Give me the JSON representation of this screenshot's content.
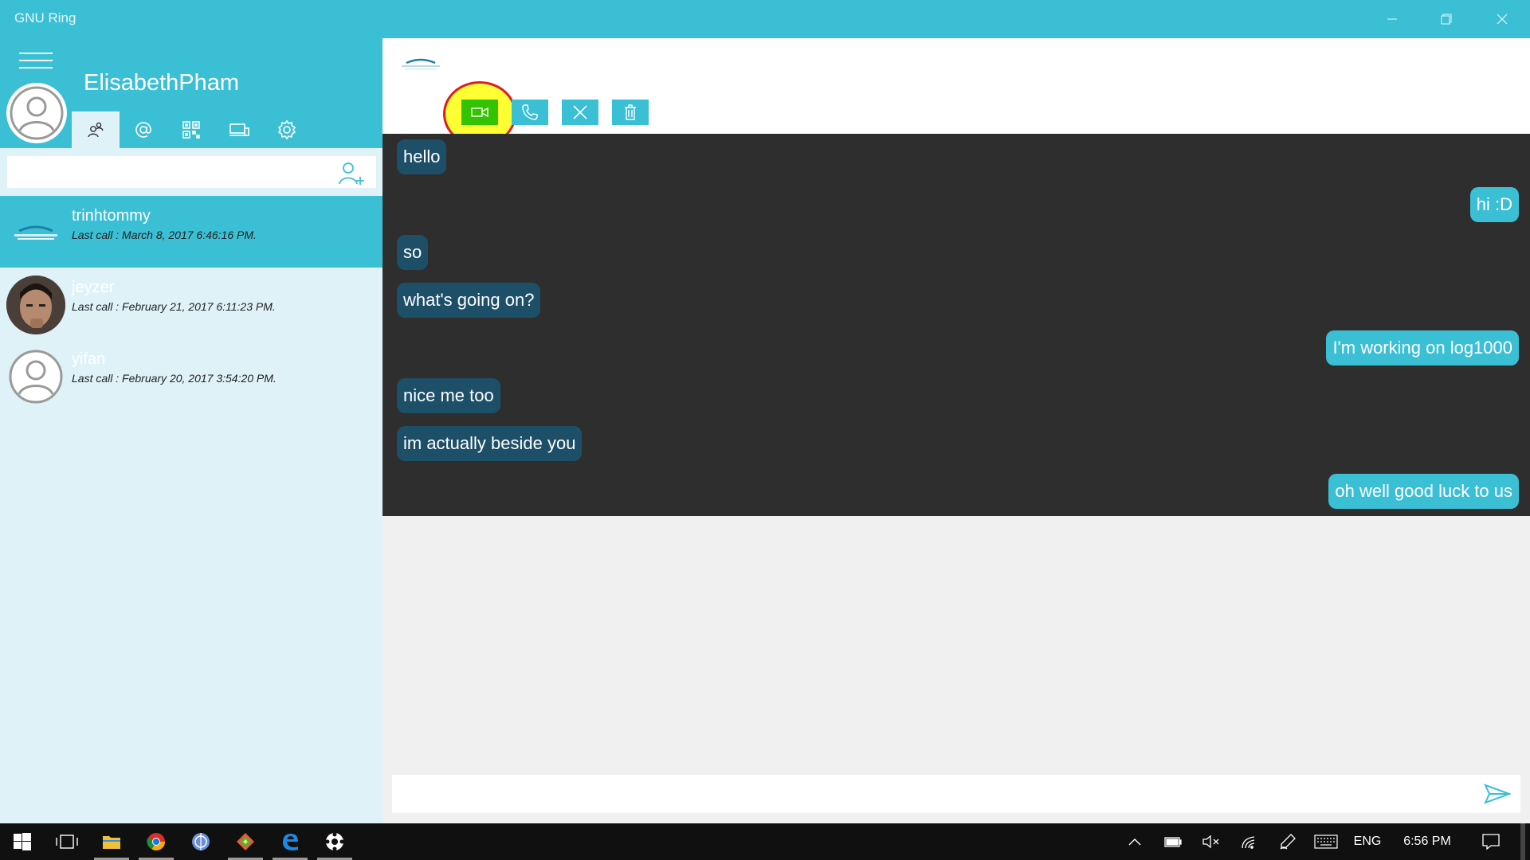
{
  "window": {
    "title": "GNU Ring"
  },
  "sidebar": {
    "username": "ElisabethPham",
    "tabs": [
      {
        "icon": "contacts-icon",
        "active": true
      },
      {
        "icon": "at-icon",
        "active": false
      },
      {
        "icon": "qr-code-icon",
        "active": false
      },
      {
        "icon": "devices-icon",
        "active": false
      },
      {
        "icon": "gear-icon",
        "active": false
      }
    ],
    "search": {
      "value": "",
      "placeholder": ""
    },
    "contacts": [
      {
        "name": "trinhtommy",
        "last": "Last call : March 8, 2017 6:46:16 PM.",
        "active": true
      },
      {
        "name": "jeyzer",
        "last": "Last call : February 21, 2017 6:11:23 PM.",
        "active": false
      },
      {
        "name": "yifan",
        "last": "Last call : February 20, 2017 3:54:20 PM.",
        "active": false
      }
    ]
  },
  "conversation": {
    "actions": [
      "video-call-icon",
      "phone-icon",
      "close-icon",
      "trash-icon"
    ],
    "messages": [
      {
        "text": "hello",
        "dir": "in"
      },
      {
        "text": "hi :D",
        "dir": "out"
      },
      {
        "text": "so",
        "dir": "in"
      },
      {
        "text": "what's going on?",
        "dir": "in"
      },
      {
        "text": "I'm working on log1000",
        "dir": "out"
      },
      {
        "text": "nice me too",
        "dir": "in"
      },
      {
        "text": "im actually beside you",
        "dir": "in"
      },
      {
        "text": "oh well good luck to us",
        "dir": "out"
      }
    ],
    "composer": {
      "value": "",
      "placeholder": ""
    }
  },
  "taskbar": {
    "language": "ENG",
    "time": "6:56 PM"
  },
  "colors": {
    "accent": "#3bbfd5",
    "chat_background": "#2e2e2e",
    "incoming_bubble": "#1d4f68",
    "outgoing_bubble": "#3bbfd5",
    "highlight": "#ffff33",
    "highlight_ring": "#e01b24"
  }
}
